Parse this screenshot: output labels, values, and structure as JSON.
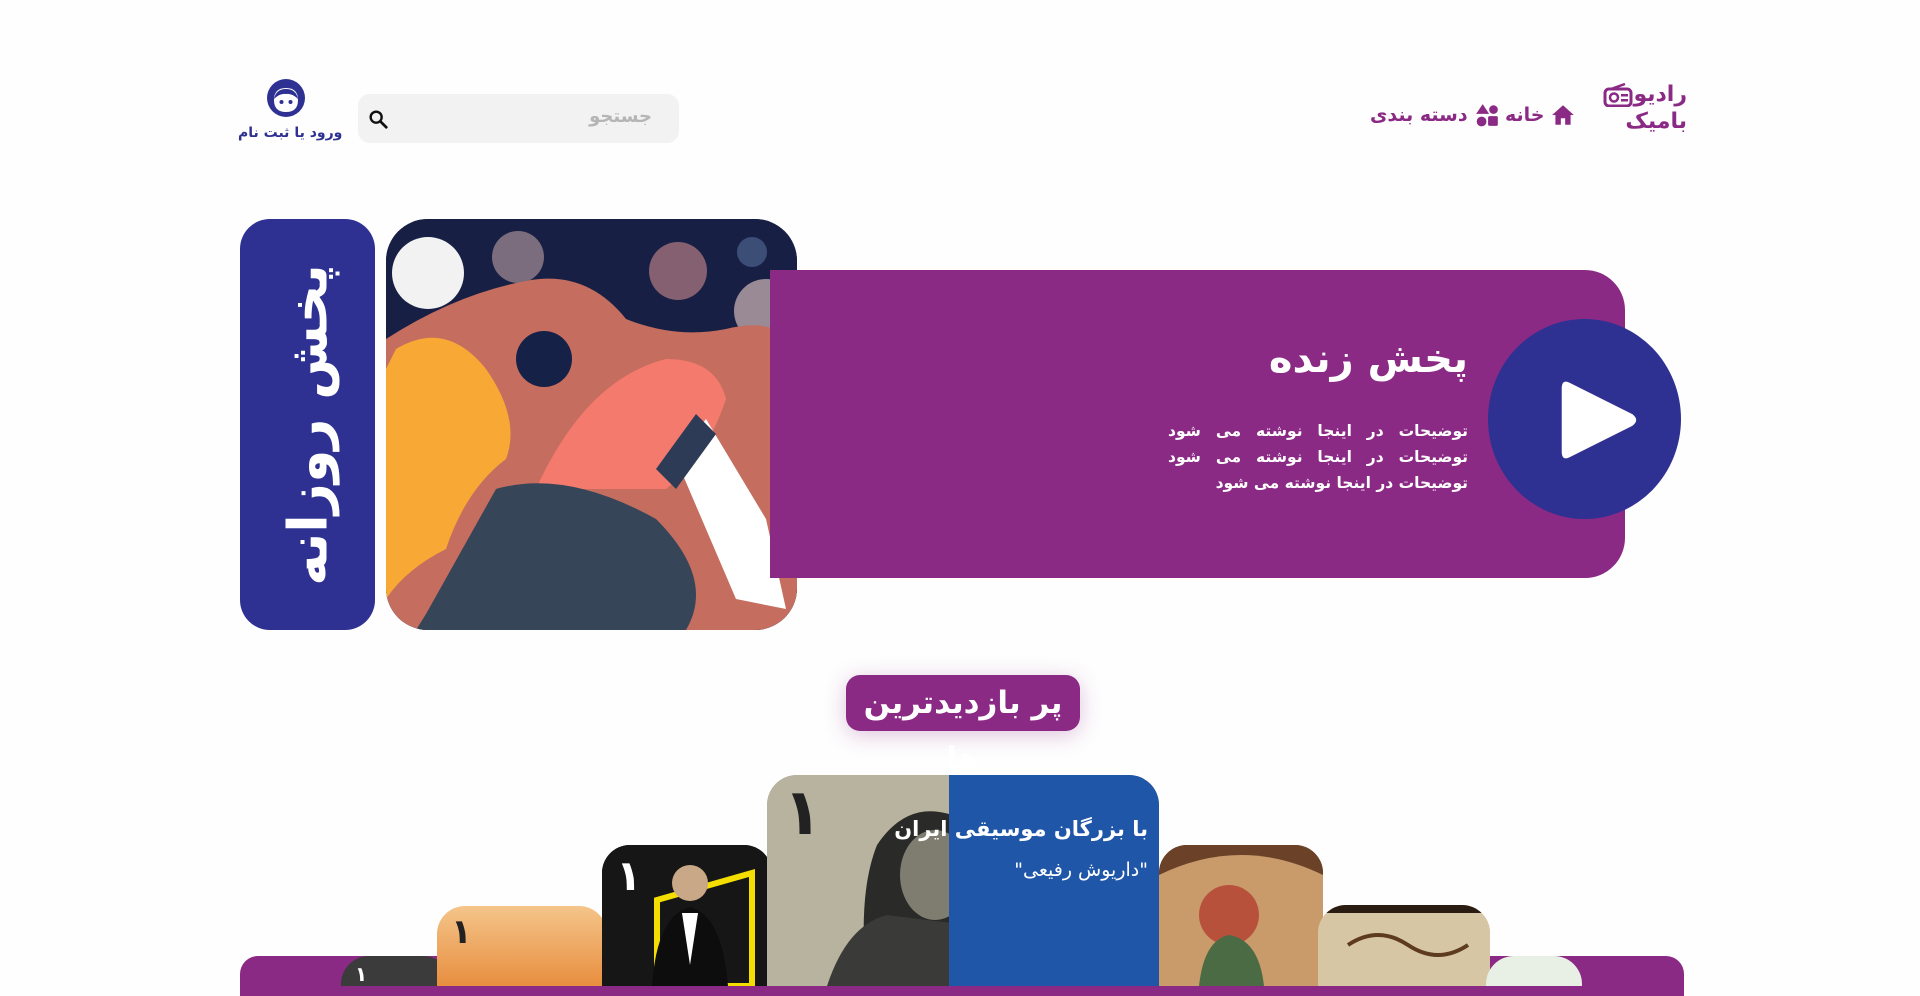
{
  "header": {
    "logo": {
      "line1": "رادیو",
      "line2": "بامیک"
    },
    "nav": [
      {
        "label": "خانه",
        "icon": "home-icon"
      },
      {
        "label": "دسته بندی",
        "icon": "category-shapes-icon"
      }
    ],
    "search": {
      "placeholder": "جستجو",
      "icon": "search-icon"
    },
    "login": {
      "label": "ورود یا ثبت نام",
      "icon": "user-avatar-icon"
    }
  },
  "hero": {
    "daily_label": "پخش روزانه",
    "live": {
      "title": "پخش زنده",
      "description": "توضیحات در اینجا نوشته می شود توضیحات در اینجا نوشته می شود توضیحات در اینجا نوشته می شود",
      "play_icon": "play-icon"
    }
  },
  "most_visited": {
    "title": "پر بازدیدترین ها",
    "cards": [
      {
        "rank": "۱"
      },
      {
        "rank": "۱"
      },
      {
        "rank": "۱"
      },
      {
        "rank": "۱",
        "title": "با بزرگان موسیقی ایران",
        "subtitle": "\"داریوش رفیعی\""
      },
      {
        "rank": ""
      },
      {
        "rank": ""
      },
      {
        "rank": ""
      }
    ]
  },
  "colors": {
    "purple": "#8b2a85",
    "navy": "#2e3192",
    "search_bg": "#f2f2f2"
  }
}
